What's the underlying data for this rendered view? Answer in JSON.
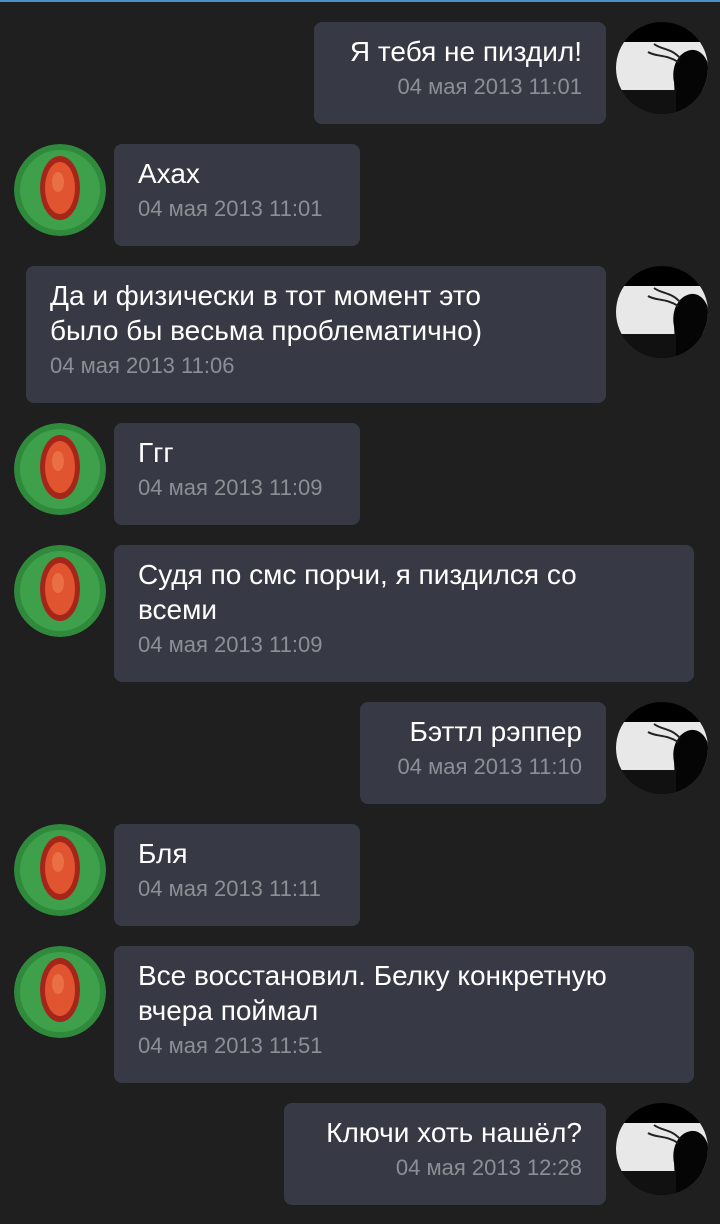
{
  "messages": [
    {
      "direction": "out",
      "text": "Я тебя не пиздил!",
      "time": "04 мая 2013 11:01"
    },
    {
      "direction": "in",
      "text": "Ахах",
      "time": "04 мая 2013 11:01"
    },
    {
      "direction": "out",
      "text": "Да и физически в тот момент это\nбыло бы весьма проблематично)",
      "time": "04 мая 2013 11:06"
    },
    {
      "direction": "in",
      "text": "Ггг",
      "time": "04 мая 2013 11:09"
    },
    {
      "direction": "in",
      "text": "Судя по смс порчи, я пиздился со\nвсеми",
      "time": "04 мая 2013 11:09"
    },
    {
      "direction": "out",
      "text": "Бэттл рэппер",
      "time": "04 мая 2013 11:10"
    },
    {
      "direction": "in",
      "text": "Бля",
      "time": "04 мая 2013 11:11"
    },
    {
      "direction": "in",
      "text": "Все восстановил. Белку конкретную\nвчера поймал",
      "time": "04 мая 2013 11:51"
    },
    {
      "direction": "out",
      "text": "Ключи хоть нашёл?",
      "time": "04 мая 2013 12:28"
    }
  ],
  "avatars": {
    "in": "melon-avatar-icon",
    "out": "silhouette-avatar-icon"
  },
  "colors": {
    "background": "#1f1f1f",
    "bubble": "#373a44",
    "text": "#ffffff",
    "timestamp": "#8c8f96"
  }
}
